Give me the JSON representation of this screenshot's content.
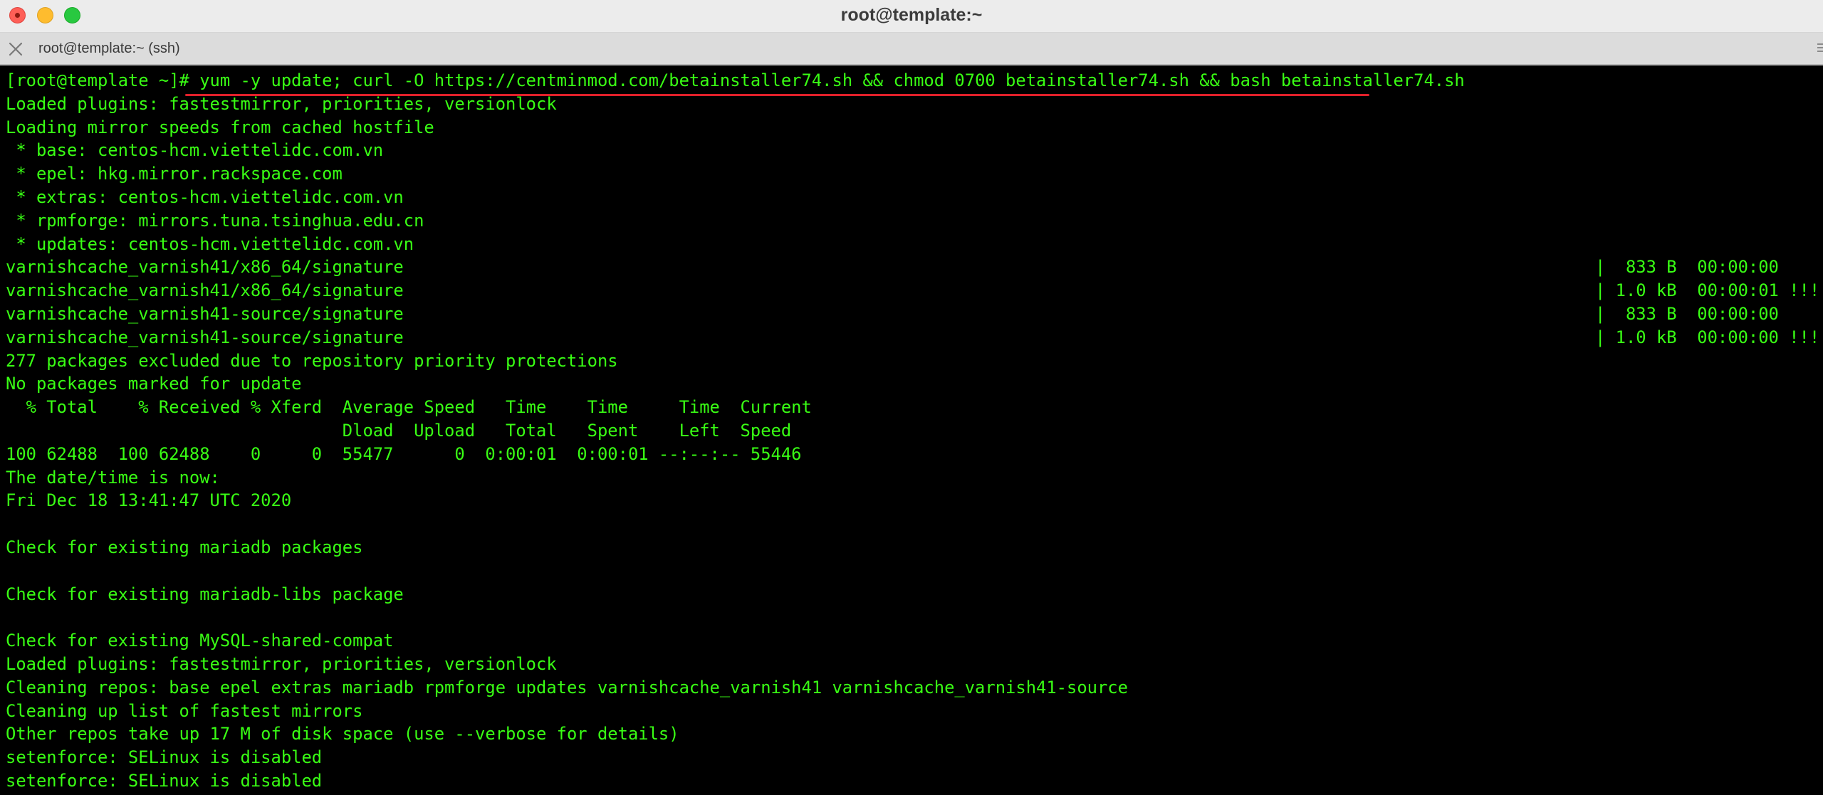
{
  "window": {
    "title": "root@template:~"
  },
  "tab": {
    "label": "root@template:~ (ssh)"
  },
  "icons": {
    "close": "close-icon",
    "minimize": "minimize-icon",
    "maximize": "maximize-icon",
    "tab_close": "tab-close-icon",
    "tab_menu": "menu-grip-icon"
  },
  "colors": {
    "terminal_fg": "#39ff14",
    "terminal_bg": "#000000",
    "underline": "#e0202a"
  },
  "terminal": {
    "prompt": "[root@template ~]# ",
    "command": "yum -y update; curl -O https://centminmod.com/betainstaller74.sh && chmod 0700 betainstaller74.sh && bash betainstaller74.sh",
    "lines": [
      {
        "text": "Loaded plugins: fastestmirror, priorities, versionlock"
      },
      {
        "text": "Loading mirror speeds from cached hostfile"
      },
      {
        "text": " * base: centos-hcm.viettelidc.com.vn"
      },
      {
        "text": " * epel: hkg.mirror.rackspace.com"
      },
      {
        "text": " * extras: centos-hcm.viettelidc.com.vn"
      },
      {
        "text": " * rpmforge: mirrors.tuna.tsinghua.edu.cn"
      },
      {
        "text": " * updates: centos-hcm.viettelidc.com.vn"
      },
      {
        "text": "varnishcache_varnish41/x86_64/signature",
        "stat": "|  833 B  00:00:00"
      },
      {
        "text": "varnishcache_varnish41/x86_64/signature",
        "stat": "| 1.0 kB  00:00:01 !!!"
      },
      {
        "text": "varnishcache_varnish41-source/signature",
        "stat": "|  833 B  00:00:00"
      },
      {
        "text": "varnishcache_varnish41-source/signature",
        "stat": "| 1.0 kB  00:00:00 !!!"
      },
      {
        "text": "277 packages excluded due to repository priority protections"
      },
      {
        "text": "No packages marked for update"
      },
      {
        "text": "  % Total    % Received % Xferd  Average Speed   Time    Time     Time  Current"
      },
      {
        "text": "                                 Dload  Upload   Total   Spent    Left  Speed"
      },
      {
        "text": "100 62488  100 62488    0     0  55477      0  0:00:01  0:00:01 --:--:-- 55446"
      },
      {
        "text": "The date/time is now:"
      },
      {
        "text": "Fri Dec 18 13:41:47 UTC 2020"
      },
      {
        "text": ""
      },
      {
        "text": "Check for existing mariadb packages"
      },
      {
        "text": ""
      },
      {
        "text": "Check for existing mariadb-libs package"
      },
      {
        "text": ""
      },
      {
        "text": "Check for existing MySQL-shared-compat"
      },
      {
        "text": "Loaded plugins: fastestmirror, priorities, versionlock"
      },
      {
        "text": "Cleaning repos: base epel extras mariadb rpmforge updates varnishcache_varnish41 varnishcache_varnish41-source"
      },
      {
        "text": "Cleaning up list of fastest mirrors"
      },
      {
        "text": "Other repos take up 17 M of disk space (use --verbose for details)"
      },
      {
        "text": "setenforce: SELinux is disabled"
      },
      {
        "text": "setenforce: SELinux is disabled"
      }
    ]
  }
}
